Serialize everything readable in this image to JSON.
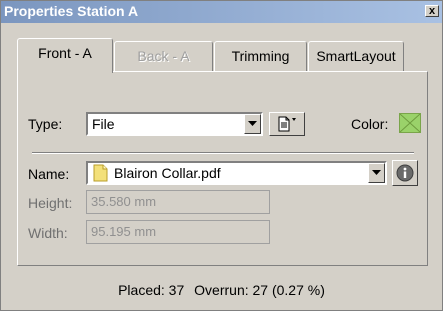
{
  "window": {
    "title": "Properties Station A",
    "close_glyph": "x"
  },
  "tabs": [
    {
      "label": "Front - A",
      "state": "active"
    },
    {
      "label": "Back - A",
      "state": "disabled"
    },
    {
      "label": "Trimming",
      "state": "normal"
    },
    {
      "label": "SmartLayout",
      "state": "normal"
    }
  ],
  "type": {
    "label": "Type:",
    "value": "File",
    "options_icon": "document-options-icon"
  },
  "color": {
    "label": "Color:",
    "swatch_hex": "#9ad26a"
  },
  "name": {
    "label": "Name:",
    "value": "Blairon Collar.pdf",
    "file_icon": "file-icon"
  },
  "height": {
    "label": "Height:",
    "value": "35.580 mm"
  },
  "width": {
    "label": "Width:",
    "value": "95.195 mm"
  },
  "status": {
    "placed": "Placed: 37",
    "overrun": "Overrun: 27 (0.27 %)"
  }
}
